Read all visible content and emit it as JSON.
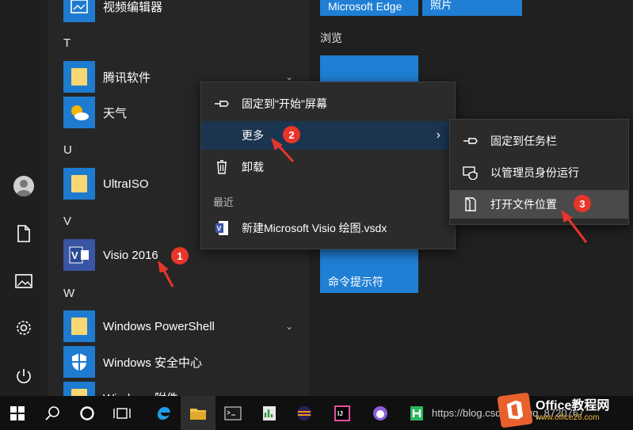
{
  "apps": {
    "video_editor": "视频编辑器",
    "group_t": "T",
    "tencent": "腾讯软件",
    "weather": "天气",
    "group_u": "U",
    "ultraiso": "UltraISO",
    "group_v": "V",
    "visio": "Visio 2016",
    "group_w": "W",
    "powershell": "Windows PowerShell",
    "security": "Windows 安全中心",
    "accessories": "Windows 附件"
  },
  "tiles": {
    "edge": "Microsoft Edge",
    "photos": "照片",
    "browse_group": "浏览",
    "cmd": "命令提示符"
  },
  "context_menu": {
    "pin_start": "固定到\"开始\"屏幕",
    "more": "更多",
    "uninstall": "卸载",
    "recent_header": "最近",
    "recent_file": "新建Microsoft Visio 绘图.vsdx"
  },
  "submenu": {
    "pin_taskbar": "固定到任务栏",
    "run_admin": "以管理员身份运行",
    "open_location": "打开文件位置"
  },
  "badges": [
    "1",
    "2",
    "3"
  ],
  "taskbar": {
    "url_text": "https://blog.csdn.net/qq_8720767"
  },
  "watermark": {
    "title": "Office教程网",
    "subtitle": "www.office26.com"
  },
  "colors": {
    "accent": "#1f7fd4",
    "badge": "#e8352b",
    "menu_bg": "#2b2b2b"
  }
}
